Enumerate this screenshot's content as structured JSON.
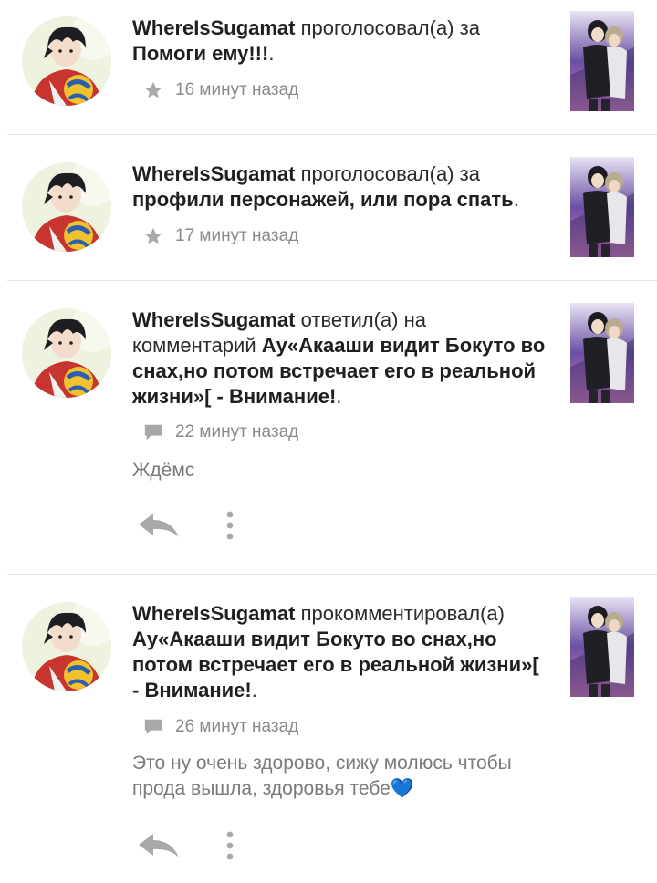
{
  "feed": {
    "items": [
      {
        "user": "WhereIsSugamat",
        "verb": "проголосовал(а) за",
        "target": "Помоги ему!!!",
        "suffix": ".",
        "meta_icon": "star-icon",
        "time": "16 минут назад"
      },
      {
        "user": "WhereIsSugamat",
        "verb": "проголосовал(а) за",
        "target": "профили персонажей, или пора спать",
        "suffix": ".",
        "meta_icon": "star-icon",
        "time": "17 минут назад"
      },
      {
        "user": "WhereIsSugamat",
        "verb": "ответил(а) на комментарий",
        "target": "Ау«Акааши видит Бокуто во снах,но потом встречает его в реальной жизни»[ - Внимание!",
        "suffix": ".",
        "meta_icon": "comment-icon",
        "time": "22 минут назад",
        "comment": "Ждёмс"
      },
      {
        "user": "WhereIsSugamat",
        "verb": "прокомментировал(а)",
        "target": "Ау«Акааши видит Бокуто во снах,но потом встречает его в реальной жизни»[ - Внимание!",
        "suffix": ".",
        "meta_icon": "comment-icon",
        "time": "26 минут назад",
        "comment": "Это ну очень здорово, сижу молюсь чтобы прода вышла, здоровья тебе💙"
      }
    ]
  },
  "colors": {
    "background": "#ffffff",
    "text": "#262626",
    "muted": "#8a8a8a",
    "divider": "#e2e2e2",
    "icon": "#a8a8a8"
  }
}
